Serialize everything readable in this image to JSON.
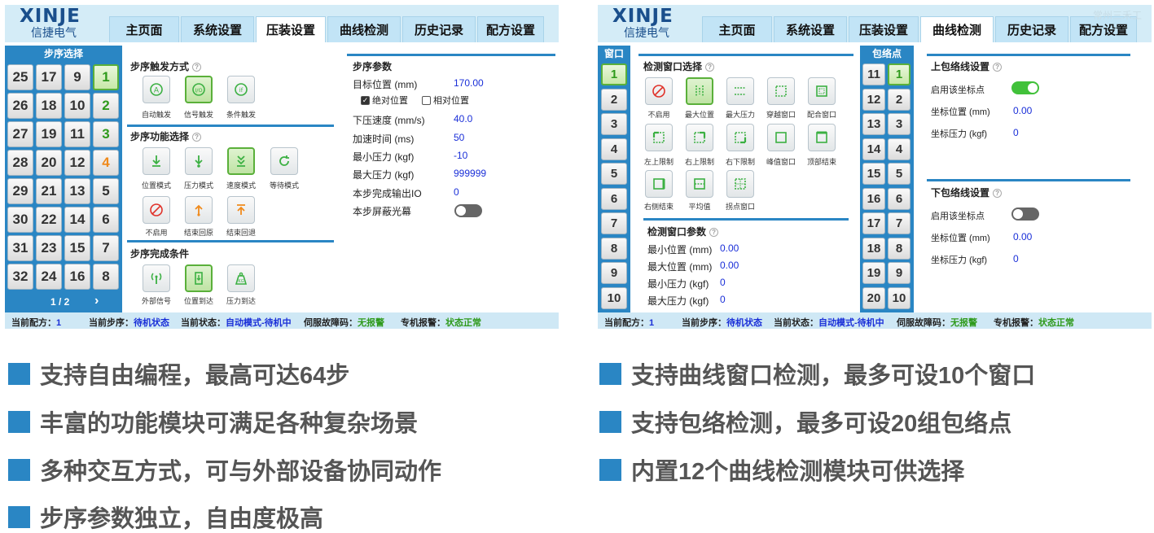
{
  "brand": {
    "logo": "XINJE",
    "sub": "信捷电气"
  },
  "tabs": [
    "主页面",
    "系统设置",
    "压装设置",
    "曲线检测",
    "历史记录",
    "配方设置"
  ],
  "watermark": "常州三禾工",
  "left": {
    "step_panel": {
      "title": "步序选择",
      "buttons": [
        "25",
        "17",
        "9",
        "1",
        "26",
        "18",
        "10",
        "2",
        "27",
        "19",
        "11",
        "3",
        "28",
        "20",
        "12",
        "4",
        "29",
        "21",
        "13",
        "5",
        "30",
        "22",
        "14",
        "6",
        "31",
        "23",
        "15",
        "7",
        "32",
        "24",
        "16",
        "8"
      ],
      "page": "1 / 2",
      "next": "›"
    },
    "trigger": {
      "title": "步序触发方式",
      "help": "?",
      "items": [
        {
          "label": "自动触发",
          "icon": "auto-trigger-icon"
        },
        {
          "label": "信号触发",
          "icon": "signal-trigger-icon"
        },
        {
          "label": "条件触发",
          "icon": "condition-trigger-icon"
        }
      ]
    },
    "function": {
      "title": "步序功能选择",
      "help": "?",
      "items": [
        {
          "label": "位置模式",
          "icon": "position-mode-icon"
        },
        {
          "label": "压力模式",
          "icon": "pressure-mode-icon"
        },
        {
          "label": "速度模式",
          "icon": "speed-mode-icon"
        },
        {
          "label": "等待模式",
          "icon": "wait-mode-icon"
        },
        {
          "label": "不启用",
          "icon": "disabled-icon"
        },
        {
          "label": "结束回原",
          "icon": "return-origin-icon"
        },
        {
          "label": "结束回退",
          "icon": "retreat-icon"
        }
      ]
    },
    "complete": {
      "title": "步序完成条件",
      "items": [
        {
          "label": "外部信号",
          "icon": "external-signal-icon"
        },
        {
          "label": "位置到达",
          "icon": "position-reached-icon"
        },
        {
          "label": "压力到达",
          "icon": "pressure-reached-icon"
        }
      ]
    },
    "params": {
      "title": "步序参数",
      "target_label": "目标位置 (mm)",
      "target_value": "170.00",
      "abs_label": "绝对位置",
      "rel_label": "相对位置",
      "speed_label": "下压速度 (mm/s)",
      "speed_value": "40.0",
      "accel_label": "加速时间 (ms)",
      "accel_value": "50",
      "minp_label": "最小压力 (kgf)",
      "minp_value": "-10",
      "maxp_label": "最大压力 (kgf)",
      "maxp_value": "999999",
      "io_label": "本步完成输出IO",
      "io_value": "0",
      "curtain_label": "本步屏蔽光幕"
    }
  },
  "right": {
    "window_panel": {
      "title": "窗口",
      "buttons": [
        "1",
        "2",
        "3",
        "4",
        "5",
        "6",
        "7",
        "8",
        "9",
        "10"
      ]
    },
    "detect": {
      "title": "检测窗口选择",
      "help": "?",
      "items": [
        {
          "label": "不启用",
          "icon": "disabled-icon"
        },
        {
          "label": "最大位置",
          "icon": "max-position-icon"
        },
        {
          "label": "最大压力",
          "icon": "max-pressure-icon"
        },
        {
          "label": "穿越窗口",
          "icon": "cross-window-icon"
        },
        {
          "label": "配合窗口",
          "icon": "fit-window-icon"
        },
        {
          "label": "左上限制",
          "icon": "upper-left-limit-icon"
        },
        {
          "label": "右上限制",
          "icon": "upper-right-limit-icon"
        },
        {
          "label": "右下限制",
          "icon": "lower-right-limit-icon"
        },
        {
          "label": "峰值窗口",
          "icon": "peak-window-icon"
        },
        {
          "label": "顶部结束",
          "icon": "top-end-icon"
        },
        {
          "label": "右侧结束",
          "icon": "right-end-icon"
        },
        {
          "label": "平均值",
          "icon": "average-icon"
        },
        {
          "label": "拐点窗口",
          "icon": "inflection-window-icon"
        }
      ]
    },
    "window_params": {
      "title": "检测窗口参数",
      "help": "?",
      "rows": [
        {
          "label": "最小位置 (mm)",
          "value": "0.00"
        },
        {
          "label": "最大位置 (mm)",
          "value": "0.00"
        },
        {
          "label": "最小压力 (kgf)",
          "value": "0"
        },
        {
          "label": "最大压力 (kgf)",
          "value": "0"
        }
      ]
    },
    "envelope_panel": {
      "title": "包络点",
      "buttons": [
        "11",
        "1",
        "12",
        "2",
        "13",
        "3",
        "14",
        "4",
        "15",
        "5",
        "16",
        "6",
        "17",
        "7",
        "18",
        "8",
        "19",
        "9",
        "20",
        "10"
      ]
    },
    "upper": {
      "title": "上包络线设置",
      "help": "?",
      "enable_label": "启用该坐标点",
      "enabled": true,
      "pos_label": "坐标位置 (mm)",
      "pos_value": "0.00",
      "force_label": "坐标压力 (kgf)",
      "force_value": "0"
    },
    "lower": {
      "title": "下包络线设置",
      "help": "?",
      "enable_label": "启用该坐标点",
      "enabled": false,
      "pos_label": "坐标位置 (mm)",
      "pos_value": "0.00",
      "force_label": "坐标压力 (kgf)",
      "force_value": "0"
    }
  },
  "status": {
    "recipe_label": "当前配方：",
    "recipe_value": "1",
    "step_label": "当前步序：",
    "step_value": "待机状态",
    "state_label": "当前状态：",
    "state_value": "自动模式-待机中",
    "servo_label": "伺服故障码：",
    "servo_value": "无报警",
    "alarm_label": "专机报警：",
    "alarm_value": "状态正常"
  },
  "features_left": [
    "支持自由编程，最高可达64步",
    "丰富的功能模块可满足各种复杂场景",
    "多种交互方式，可与外部设备协同动作",
    "步序参数独立，自由度极高"
  ],
  "features_right": [
    "支持曲线窗口检测，最多可设10个窗口",
    "支持包络检测，最多可设20组包络点",
    "内置12个曲线检测模块可供选择"
  ],
  "colors": {
    "accent": "#2a86c4",
    "header": "#d4ecf7",
    "green": "#5ab03a",
    "value_blue": "#1a2fd8"
  }
}
